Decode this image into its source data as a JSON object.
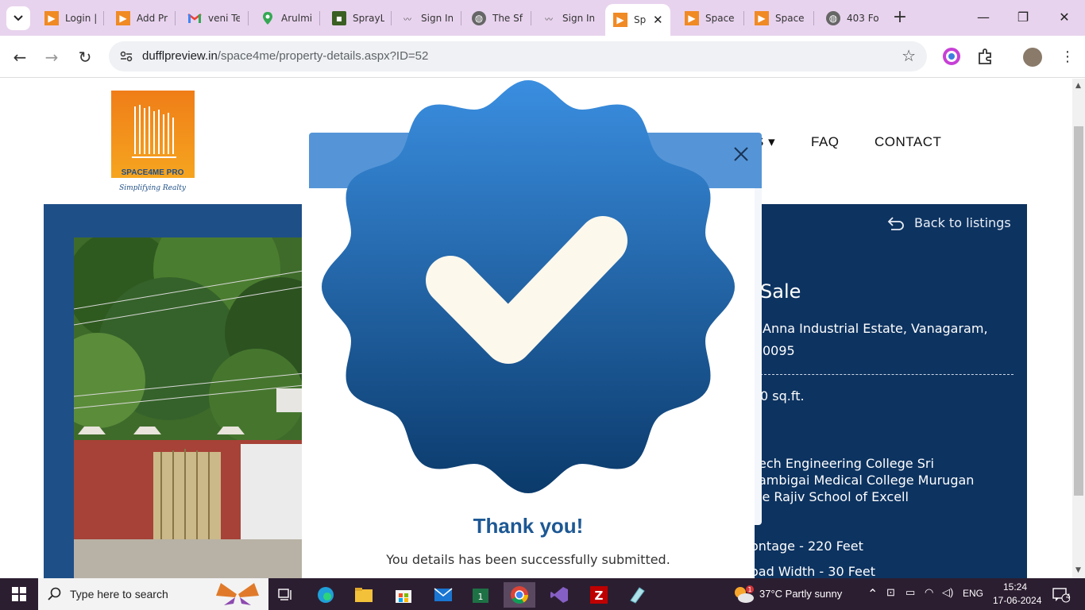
{
  "browser": {
    "tabs": [
      {
        "title": "Login |",
        "icon": "orange-square-icon"
      },
      {
        "title": "Add Pr",
        "icon": "orange-square-icon"
      },
      {
        "title": "veni Te",
        "icon": "gmail-icon"
      },
      {
        "title": "Arulmi",
        "icon": "maps-pin-icon"
      },
      {
        "title": "SprayL",
        "icon": "shop-icon"
      },
      {
        "title": "Sign In",
        "icon": "wave-logo-icon"
      },
      {
        "title": "The Sf",
        "icon": "globe-icon"
      },
      {
        "title": "Sign In",
        "icon": "wave-logo-icon"
      },
      {
        "title": "Sp",
        "icon": "orange-square-icon",
        "active": true
      },
      {
        "title": "Space",
        "icon": "orange-square-icon"
      },
      {
        "title": "Space",
        "icon": "orange-square-icon"
      },
      {
        "title": "403 Fo",
        "icon": "globe-icon"
      }
    ],
    "url_host": "dufflpreview.in",
    "url_path": "/space4me/property-details.aspx?ID=52"
  },
  "site": {
    "logo_text": "SPACE4ME PRO",
    "logo_tagline": "Simplifying Realty",
    "nav": {
      "dropdown_fragment": "S",
      "faq": "FAQ",
      "contact": "CONTACT"
    }
  },
  "property": {
    "back_label": "Back to listings",
    "title_fragment": "Sale",
    "address_line1": "Anna Industrial Estate, Vanagaram,",
    "address_line2": "0095",
    "area": "0 sq.ft.",
    "nearby_line1": "ech Engineering College Sri",
    "nearby_line2": "ambigai Medical College Murugan",
    "nearby_line3": "le Rajiv School of Excell",
    "frontage": "ontage - 220 Feet",
    "road_width": "oad Width - 30 Feet"
  },
  "modal": {
    "heading": "Thank you!",
    "message": "You details has been successfully submitted.",
    "colors": {
      "badge_top": "#3a8ee0",
      "badge_bottom": "#0b3a6b",
      "check": "#fdf8ec",
      "heading": "#1d5894"
    }
  },
  "taskbar": {
    "search_placeholder": "Type here to search",
    "weather": "37°C  Partly sunny",
    "lang": "ENG",
    "time": "15:24",
    "date": "17-06-2024",
    "notification_count": "4"
  }
}
